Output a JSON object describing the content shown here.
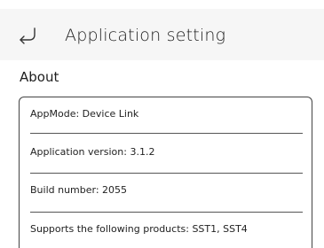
{
  "header": {
    "back_icon": "back-arrow-icon",
    "title": "Application setting"
  },
  "about": {
    "section_title": "About",
    "rows": [
      {
        "label": "AppMode: Device Link"
      },
      {
        "label": "Application version: 3.1.2"
      },
      {
        "label": "Build number: 2055"
      },
      {
        "label": "Supports the following products: SST1, SST4"
      }
    ]
  }
}
